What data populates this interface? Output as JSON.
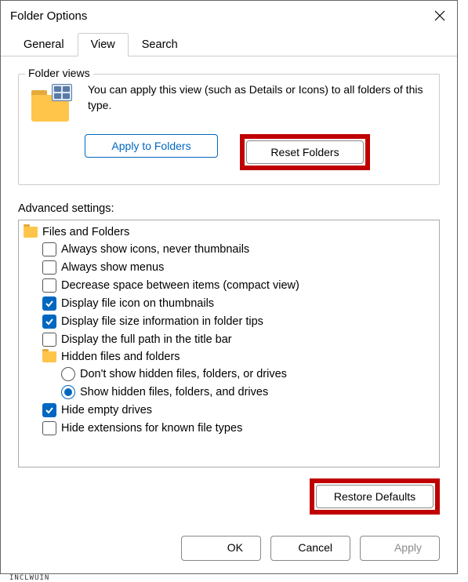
{
  "window": {
    "title": "Folder Options"
  },
  "tabs": [
    {
      "label": "General",
      "active": false
    },
    {
      "label": "View",
      "active": true
    },
    {
      "label": "Search",
      "active": false
    }
  ],
  "folderViews": {
    "legend": "Folder views",
    "description": "You can apply this view (such as Details or Icons) to all folders of this type.",
    "applyButton": "Apply to Folders",
    "resetButton": "Reset Folders"
  },
  "advanced": {
    "label": "Advanced settings:",
    "rootLabel": "Files and Folders",
    "items": [
      {
        "type": "checkbox",
        "checked": false,
        "label": "Always show icons, never thumbnails"
      },
      {
        "type": "checkbox",
        "checked": false,
        "label": "Always show menus"
      },
      {
        "type": "checkbox",
        "checked": false,
        "label": "Decrease space between items (compact view)"
      },
      {
        "type": "checkbox",
        "checked": true,
        "label": "Display file icon on thumbnails"
      },
      {
        "type": "checkbox",
        "checked": true,
        "label": "Display file size information in folder tips"
      },
      {
        "type": "checkbox",
        "checked": false,
        "label": "Display the full path in the title bar"
      }
    ],
    "hiddenGroup": {
      "label": "Hidden files and folders",
      "options": [
        {
          "checked": false,
          "label": "Don't show hidden files, folders, or drives"
        },
        {
          "checked": true,
          "label": "Show hidden files, folders, and drives"
        }
      ]
    },
    "items2": [
      {
        "type": "checkbox",
        "checked": true,
        "label": "Hide empty drives"
      },
      {
        "type": "checkbox",
        "checked": false,
        "label": "Hide extensions for known file types"
      }
    ]
  },
  "restoreButton": "Restore Defaults",
  "footer": {
    "ok": "OK",
    "cancel": "Cancel",
    "apply": "Apply"
  },
  "behind": "INCLWUIN"
}
